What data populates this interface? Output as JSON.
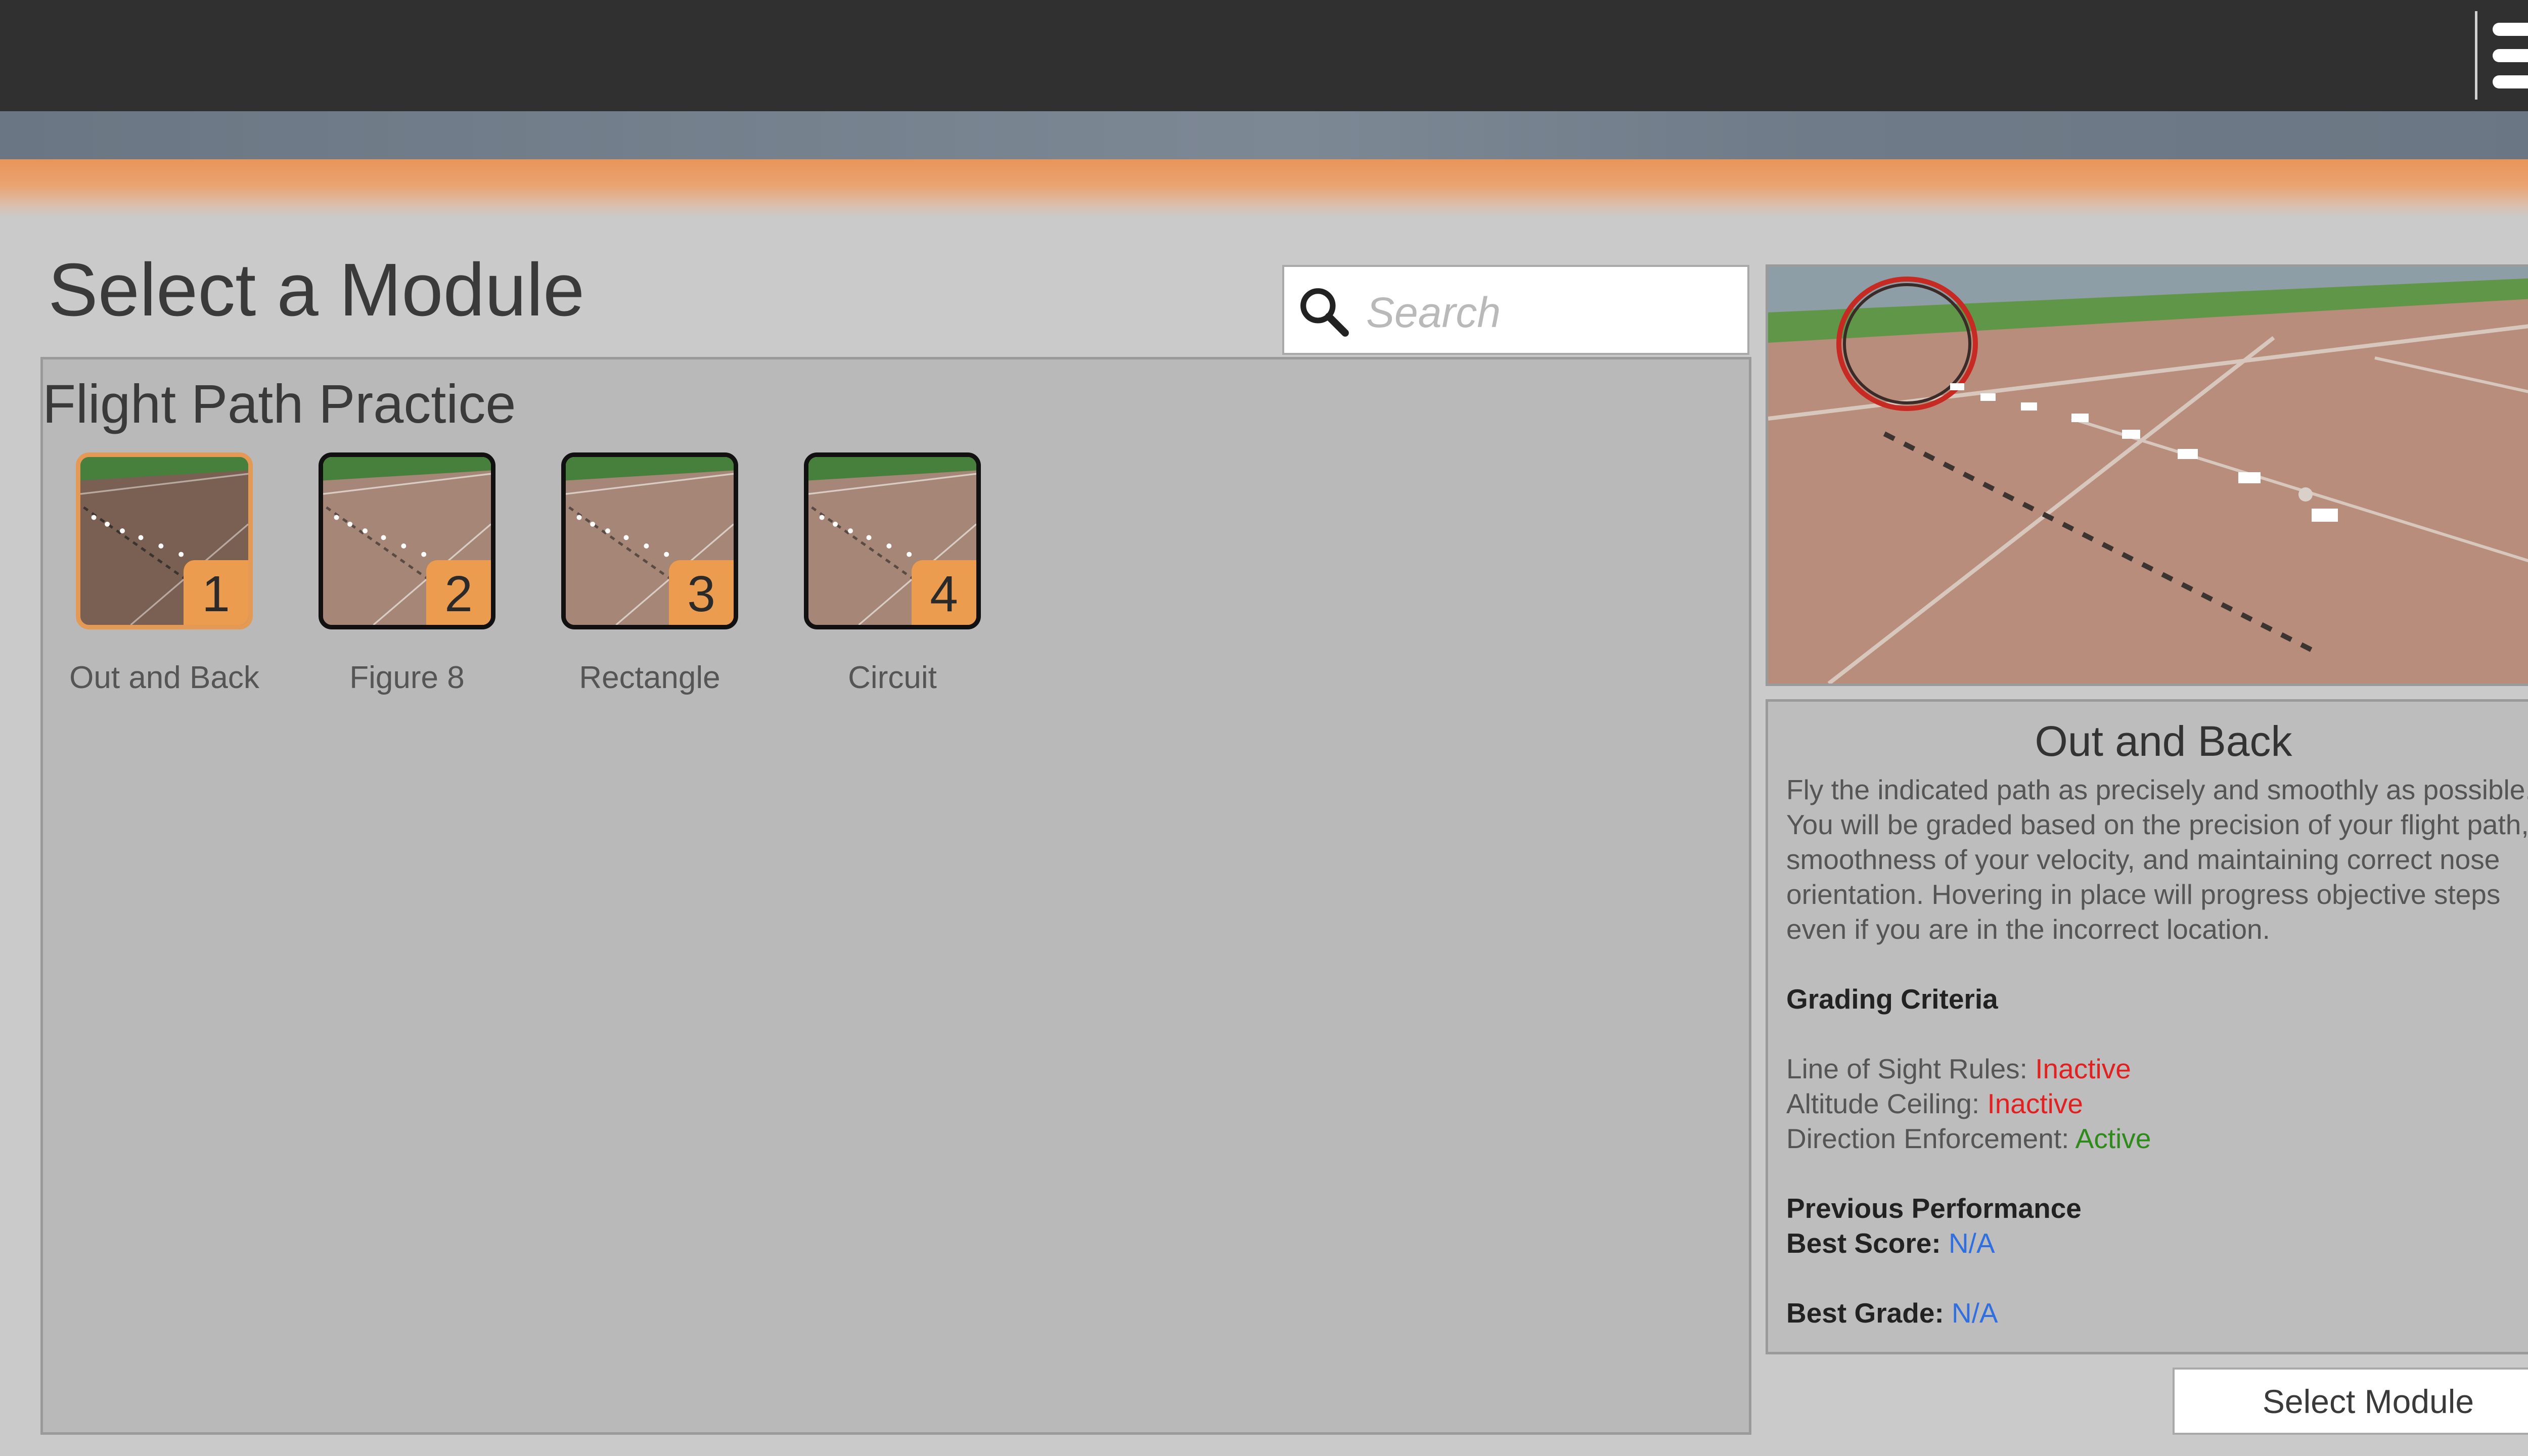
{
  "header": {
    "menu_icon": "hamburger-menu-icon"
  },
  "page": {
    "title": "Select a Module"
  },
  "search": {
    "placeholder": "Search",
    "value": "",
    "icon": "search-icon"
  },
  "section": {
    "title": "Flight Path Practice"
  },
  "modules": [
    {
      "number": "1",
      "label": "Out and Back",
      "selected": true
    },
    {
      "number": "2",
      "label": "Figure 8",
      "selected": false
    },
    {
      "number": "3",
      "label": "Rectangle",
      "selected": false
    },
    {
      "number": "4",
      "label": "Circuit",
      "selected": false
    }
  ],
  "details": {
    "title": "Out and Back",
    "description": "Fly the indicated path as precisely and smoothly as possible. You will be graded based on the precision of your flight path, smoothness of your velocity, and maintaining correct nose orientation. Hovering in place will progress objective steps even if you are in the incorrect location.",
    "grading_heading": "Grading Criteria",
    "criteria": [
      {
        "label": "Line of Sight Rules:",
        "value": "Inactive",
        "status": "inactive"
      },
      {
        "label": "Altitude Ceiling:",
        "value": "Inactive",
        "status": "inactive"
      },
      {
        "label": "Direction Enforcement:",
        "value": "Active",
        "status": "active"
      }
    ],
    "performance_heading": "Previous Performance",
    "best_score_label": "Best Score:",
    "best_score_value": "N/A",
    "best_grade_label": "Best Grade:",
    "best_grade_value": "N/A"
  },
  "actions": {
    "select_label": "Select Module"
  },
  "colors": {
    "accent": "#eb9c4f",
    "inactive": "#e32020",
    "active": "#2f8a1c",
    "na": "#2f6fe0",
    "topbar": "#303030"
  }
}
